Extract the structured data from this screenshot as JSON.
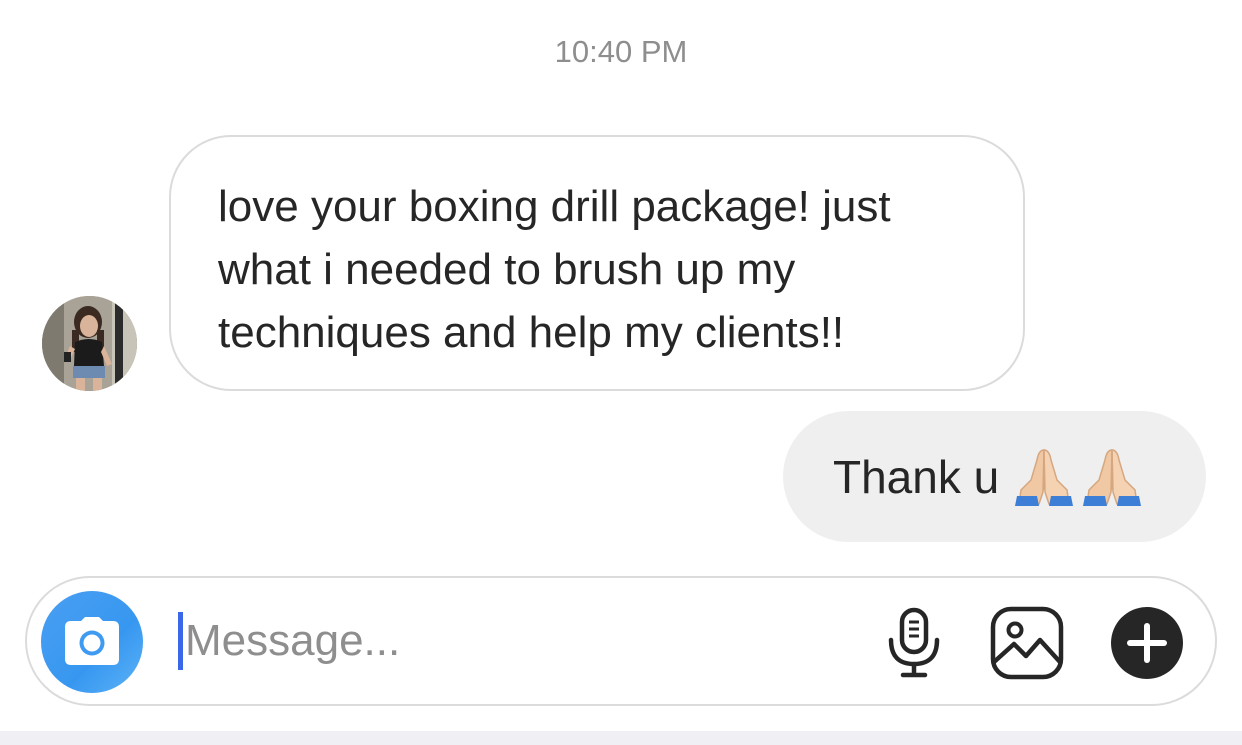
{
  "conversation": {
    "timestamp": "10:40 PM",
    "messages": [
      {
        "direction": "incoming",
        "lines": [
          "love your boxing drill package! just",
          "what i needed to brush up my",
          "techniques and help my clients!!"
        ]
      },
      {
        "direction": "outgoing",
        "text": "Thank u",
        "emojis": [
          "folded-hands",
          "folded-hands"
        ]
      }
    ]
  },
  "composer": {
    "placeholder": "Message...",
    "value": "",
    "icons": [
      "camera-icon",
      "microphone-icon",
      "gallery-icon",
      "plus-icon"
    ]
  },
  "colors": {
    "accent_blue": "#3797f0",
    "incoming_border": "#dbdbdb",
    "outgoing_bubble": "#efefef",
    "timestamp_gray": "#8e8e8e",
    "caret": "#3a68e8"
  }
}
